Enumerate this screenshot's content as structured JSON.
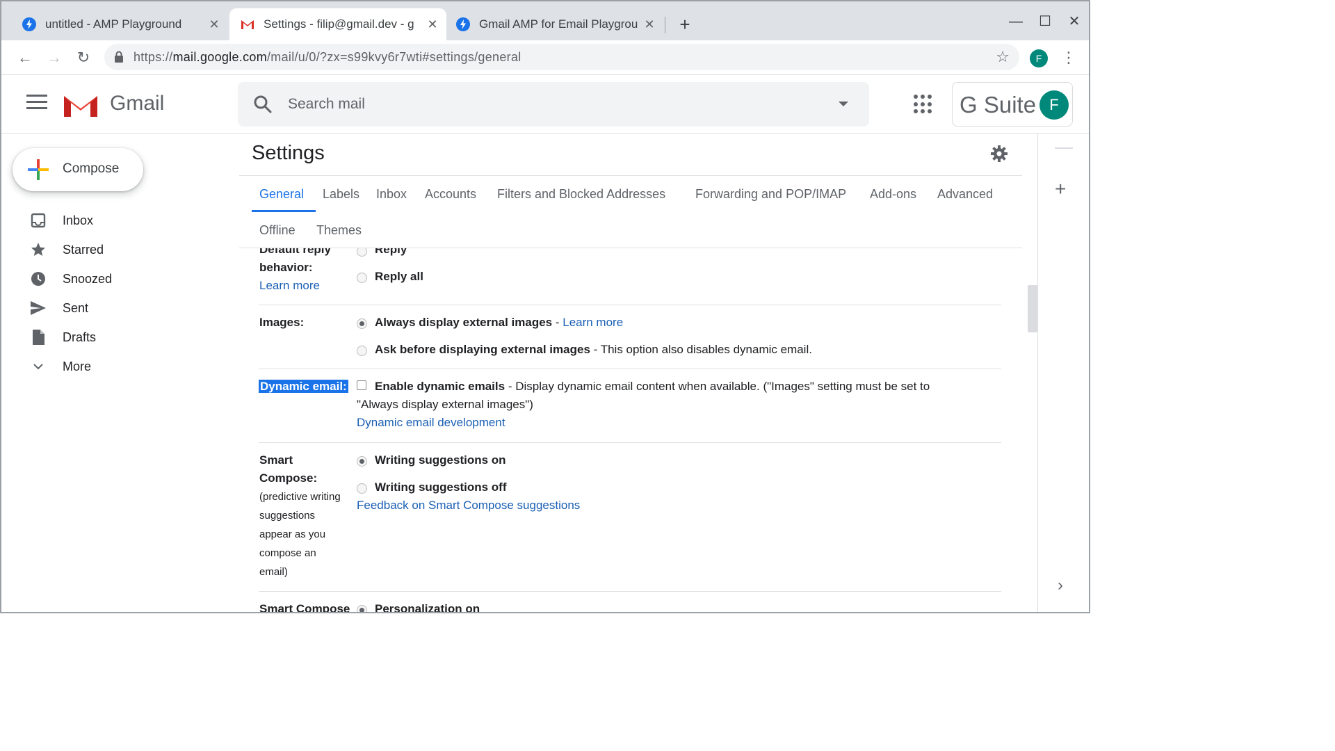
{
  "browser": {
    "tabs": [
      {
        "title": "untitled - AMP Playground",
        "icon": "amp-bolt-icon"
      },
      {
        "title": "Settings - filip@gmail.dev - g",
        "icon": "gmail-m-icon"
      },
      {
        "title": "Gmail AMP for Email Playgrou",
        "icon": "amp-bolt-icon"
      }
    ],
    "url_prefix": "https://",
    "url_host": "mail.google.com",
    "url_path": "/mail/u/0/?zx=s99kvy6r7wti#settings/general",
    "profile_initial": "F"
  },
  "gmail": {
    "brand": "Gmail",
    "search_placeholder": "Search mail",
    "gsuite": "G Suite",
    "account_initial": "F",
    "compose": "Compose",
    "nav": [
      "Inbox",
      "Starred",
      "Snoozed",
      "Sent",
      "Drafts",
      "More"
    ]
  },
  "settings": {
    "title": "Settings",
    "tabs": [
      "General",
      "Labels",
      "Inbox",
      "Accounts",
      "Filters and Blocked Addresses",
      "Forwarding and POP/IMAP",
      "Add-ons",
      "Advanced",
      "Offline",
      "Themes"
    ],
    "active_tab": "General",
    "reply": {
      "label_line1": "Default reply",
      "label_line2": "behavior:",
      "learn_more": "Learn more",
      "opt1": "Reply",
      "opt2": "Reply all"
    },
    "images": {
      "label": "Images:",
      "opt1_bold": "Always display external images",
      "opt1_sep": " - ",
      "opt1_link": "Learn more",
      "opt2_bold": "Ask before displaying external images",
      "opt2_rest": " - This option also disables dynamic email."
    },
    "dynamic": {
      "label": "Dynamic email:",
      "opt_bold": "Enable dynamic emails",
      "opt_rest": " - Display dynamic email content when available. (\"Images\" setting must be set to",
      "opt_rest2": "\"Always display external images\")",
      "link": "Dynamic email development"
    },
    "smart_compose": {
      "label_line1": "Smart",
      "label_line2": "Compose:",
      "desc": [
        "(predictive writing",
        "suggestions",
        "appear as you",
        "compose an",
        "email)"
      ],
      "opt1": "Writing suggestions on",
      "opt2": "Writing suggestions off",
      "link": "Feedback on Smart Compose suggestions"
    },
    "smart_compose_personal": {
      "label": "Smart Compose",
      "opt1": "Personalization on"
    }
  },
  "colors": {
    "accent": "#1a73e8",
    "link": "#1a5fb4",
    "avatar": "#00897b"
  }
}
